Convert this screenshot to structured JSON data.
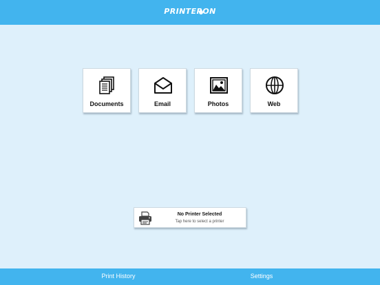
{
  "header": {
    "logo_text": "PRINTERON"
  },
  "tiles": [
    {
      "label": "Documents",
      "icon": "documents-icon"
    },
    {
      "label": "Email",
      "icon": "envelope-icon"
    },
    {
      "label": "Photos",
      "icon": "photo-icon"
    },
    {
      "label": "Web",
      "icon": "globe-icon"
    }
  ],
  "printer": {
    "title": "No Printer Selected",
    "subtitle": "Tap here to select a printer",
    "icon": "printer-icon"
  },
  "bottom_bar": {
    "history_label": "Print History",
    "settings_label": "Settings"
  },
  "colors": {
    "header": "#42b4ee",
    "background": "#def0fb",
    "tile": "#ffffff"
  }
}
